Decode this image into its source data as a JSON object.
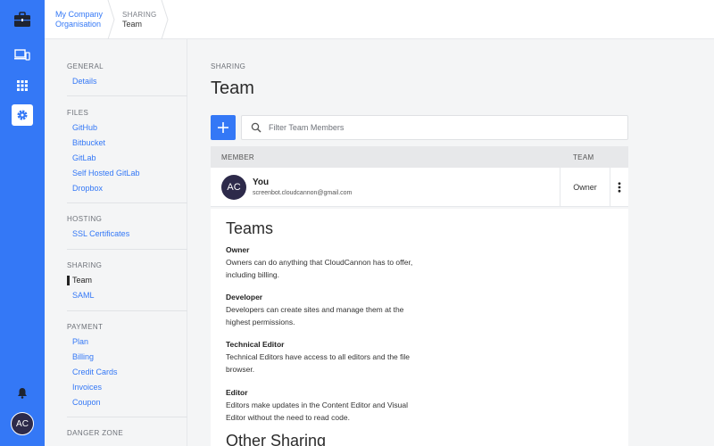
{
  "rail": {
    "avatar_initials": "AC",
    "icons": [
      "briefcase-icon",
      "devices-icon",
      "apps-grid-icon",
      "gear-icon",
      "bell-icon"
    ],
    "accent": "#3478f6"
  },
  "breadcrumb": {
    "org_line1": "My Company",
    "org_line2": "Organisation",
    "section": "SHARING",
    "current": "Team"
  },
  "nav": {
    "general": {
      "title": "GENERAL",
      "items": [
        "Details"
      ]
    },
    "files": {
      "title": "FILES",
      "items": [
        "GitHub",
        "Bitbucket",
        "GitLab",
        "Self Hosted GitLab",
        "Dropbox"
      ]
    },
    "hosting": {
      "title": "HOSTING",
      "items": [
        "SSL Certificates"
      ]
    },
    "sharing": {
      "title": "SHARING",
      "items": [
        "Team",
        "SAML"
      ],
      "active": "Team"
    },
    "payment": {
      "title": "PAYMENT",
      "items": [
        "Plan",
        "Billing",
        "Credit Cards",
        "Invoices",
        "Coupon"
      ]
    },
    "danger": {
      "title": "DANGER ZONE"
    }
  },
  "main": {
    "section_label": "SHARING",
    "title": "Team",
    "search_placeholder": "Filter Team Members",
    "table": {
      "col_member": "MEMBER",
      "col_team": "TEAM",
      "rows": [
        {
          "initials": "AC",
          "name": "You",
          "email": "screenbot.cloudcannon@gmail.com",
          "role": "Owner"
        }
      ]
    },
    "teams_info": {
      "title": "Teams",
      "roles": [
        {
          "name": "Owner",
          "line1": "Owners can do anything that CloudCannon has to offer,",
          "line2": "including billing."
        },
        {
          "name": "Developer",
          "line1": "Developers can create sites and manage them at the",
          "line2": "highest permissions."
        },
        {
          "name": "Technical Editor",
          "line1": "Technical Editors have access to all editors and the file",
          "line2": "browser."
        },
        {
          "name": "Editor",
          "line1": "Editors make updates in the Content Editor and Visual",
          "line2": "Editor without the need to read code."
        }
      ],
      "other_title": "Other Sharing"
    }
  }
}
